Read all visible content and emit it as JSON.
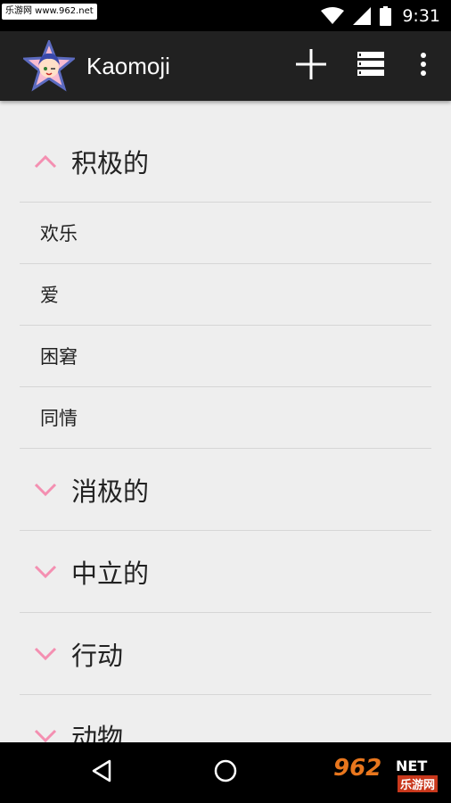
{
  "status_bar": {
    "watermark": "乐游网 www.962.net",
    "time": "9:31",
    "icons": [
      "wifi-icon",
      "signal-icon",
      "battery-icon"
    ]
  },
  "app_bar": {
    "title": "Kaomoji",
    "actions": [
      "add-icon",
      "list-view-icon",
      "more-vert-icon"
    ]
  },
  "list": {
    "groups": [
      {
        "label": "积极的",
        "expanded": true,
        "children": [
          "欢乐",
          "爱",
          "困窘",
          "同情"
        ]
      },
      {
        "label": "消极的",
        "expanded": false
      },
      {
        "label": "中立的",
        "expanded": false
      },
      {
        "label": "行动",
        "expanded": false
      },
      {
        "label": "动物",
        "expanded": false
      }
    ]
  },
  "nav_bar": {
    "buttons": [
      "back-icon",
      "home-icon"
    ],
    "watermark_big": "962",
    "watermark_net": "NET",
    "watermark_cn": "乐游网"
  },
  "colors": {
    "app_bar": "#212121",
    "background": "#eeeeee",
    "chevron": "#f48fb1",
    "divider": "#d6d6d6"
  }
}
